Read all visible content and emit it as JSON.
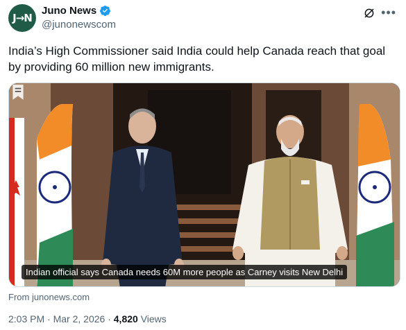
{
  "author": {
    "display_name": "Juno News",
    "handle": "@junonewscom",
    "avatar_text": "J→N"
  },
  "tweet": {
    "text": "India’s High Commissioner said India could help Canada reach that goal by providing 60 million new immigrants."
  },
  "media": {
    "caption": "Indian official says Canada needs 60M more people as Carney visits New Delhi"
  },
  "card": {
    "source": "From junonews.com"
  },
  "meta": {
    "time": "2:03 PM",
    "date": "Mar 2, 2026",
    "views": "4,820",
    "views_label": "Views",
    "separator": "·"
  },
  "colors": {
    "verified": "#1d9bf0",
    "secondary_text": "#536471",
    "avatar_bg": "#1f5b46"
  }
}
